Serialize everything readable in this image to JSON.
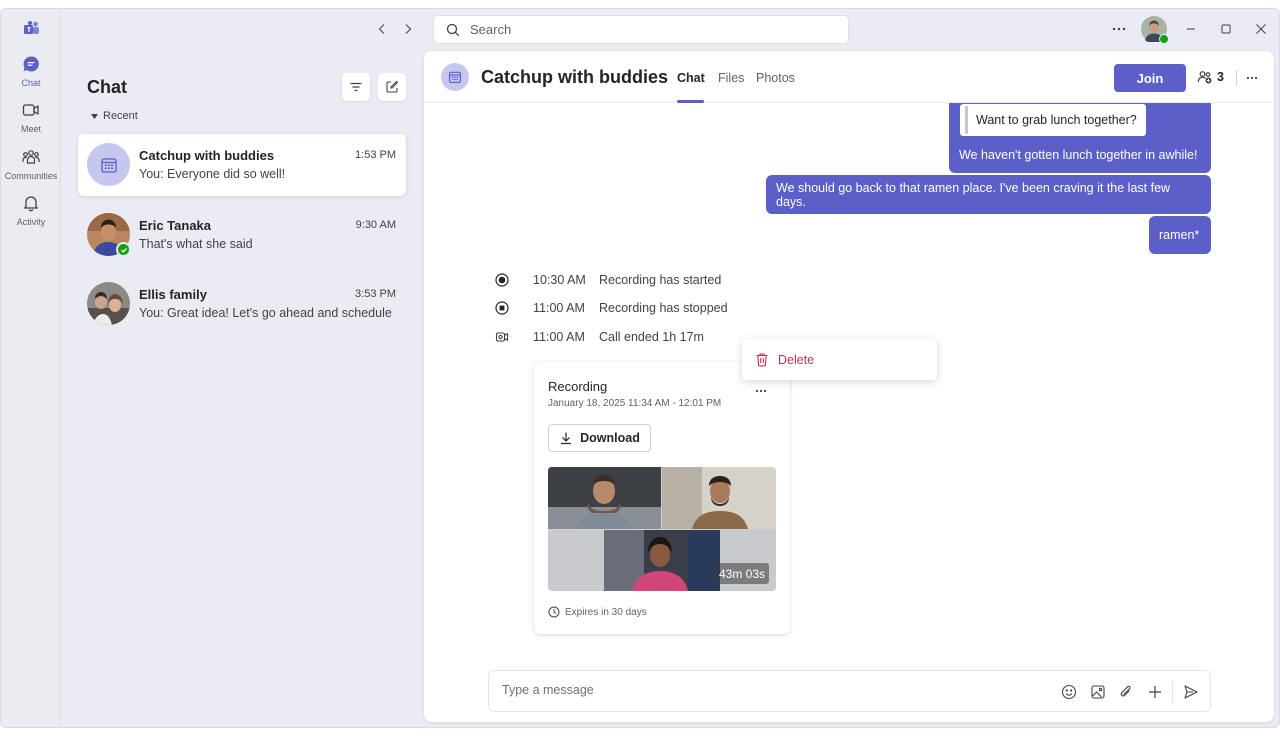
{
  "rail": {
    "items": [
      {
        "label": "Chat",
        "icon": "chat-icon"
      },
      {
        "label": "Meet",
        "icon": "video-camera-icon"
      },
      {
        "label": "Communities",
        "icon": "people-community-icon"
      },
      {
        "label": "Activity",
        "icon": "bell-icon"
      }
    ]
  },
  "titlebar": {
    "search_placeholder": "Search",
    "icons": [
      "chevron-left-icon",
      "chevron-right-icon",
      "more-icon",
      "minimize-icon",
      "maximize-icon",
      "close-icon"
    ]
  },
  "left_pane": {
    "title": "Chat",
    "section_label": "Recent",
    "chats": [
      {
        "name": "Catchup with buddies",
        "time": "1:53 PM",
        "preview": "You: Everyone did so well!",
        "avatar": "calendar-icon"
      },
      {
        "name": "Eric Tanaka",
        "time": "9:30 AM",
        "preview": "That's what she said",
        "status": "available"
      },
      {
        "name": "Ellis family",
        "time": "3:53 PM",
        "preview": "You: Great idea! Let's go ahead and schedule"
      }
    ]
  },
  "main": {
    "title": "Catchup with buddies",
    "tabs": [
      "Chat",
      "Files",
      "Photos"
    ],
    "active_tab": "Chat",
    "join_label": "Join",
    "participant_count": "3",
    "messages": {
      "quote_text": "Want to grab lunch together?",
      "bubble1": "We haven't gotten lunch together in awhile!",
      "bubble2": "We should go back to that ramen place. I've been craving it the last few days.",
      "bubble3": "ramen*"
    },
    "events": [
      {
        "time": "10:30 AM",
        "text": "Recording has started",
        "icon": "record-icon"
      },
      {
        "time": "11:00 AM",
        "text": "Recording has stopped",
        "icon": "stop-icon"
      },
      {
        "time": "11:00 AM",
        "text": "Call ended 1h 17m",
        "icon": "call-end-icon"
      }
    ],
    "context_menu": {
      "delete_label": "Delete"
    },
    "recording_card": {
      "title": "Recording",
      "date": "January 18, 2025 11:34 AM - 12:01 PM",
      "download_label": "Download",
      "duration": "43m 03s",
      "expires": "Expires in 30 days"
    },
    "composer": {
      "placeholder": "Type a message"
    }
  },
  "colors": {
    "accent": "#5b5fc7",
    "delete": "#c4314b",
    "presence": "#13a10e",
    "background": "#ebebf3"
  }
}
